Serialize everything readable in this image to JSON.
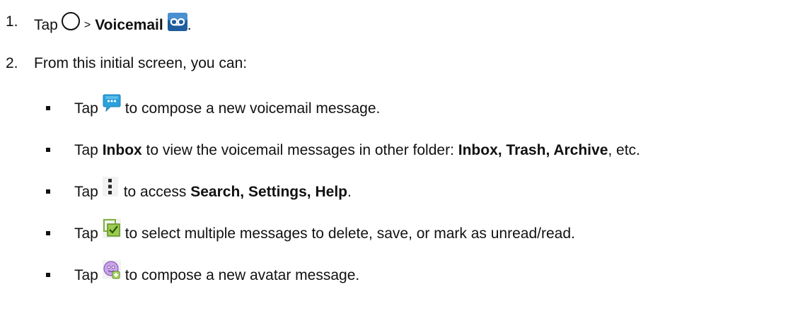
{
  "step1": {
    "number": "1.",
    "tap": "Tap",
    "sep": ">",
    "voicemail": "Voicemail",
    "period": "."
  },
  "step2": {
    "number": "2.",
    "text": "From this initial screen, you can:"
  },
  "bullets": [
    {
      "tap": "Tap",
      "icon": "compose-bubble-icon",
      "text": " to compose a new voicemail message."
    },
    {
      "tap": "Tap",
      "bold1": "Inbox",
      "text1": " to view the voicemail messages in other folder: ",
      "bold2": "Inbox, Trash, Archive",
      "text2": ", etc."
    },
    {
      "tap": "Tap",
      "icon": "overflow-menu-icon",
      "text1": " to access ",
      "bold": "Search, Settings, Help",
      "text2": "."
    },
    {
      "tap": "Tap",
      "icon": "multi-select-icon",
      "text": " to select multiple messages to delete, save, or mark as unread/read."
    },
    {
      "tap": "Tap",
      "icon": "avatar-compose-icon",
      "text": " to compose a new avatar message."
    }
  ],
  "colors": {
    "voicemail_icon": "#1f5d9c",
    "bubble_icon": "#2aa1dc",
    "checkbox_icon": "#7db23a",
    "avatar_icon": "#b07fd6"
  }
}
